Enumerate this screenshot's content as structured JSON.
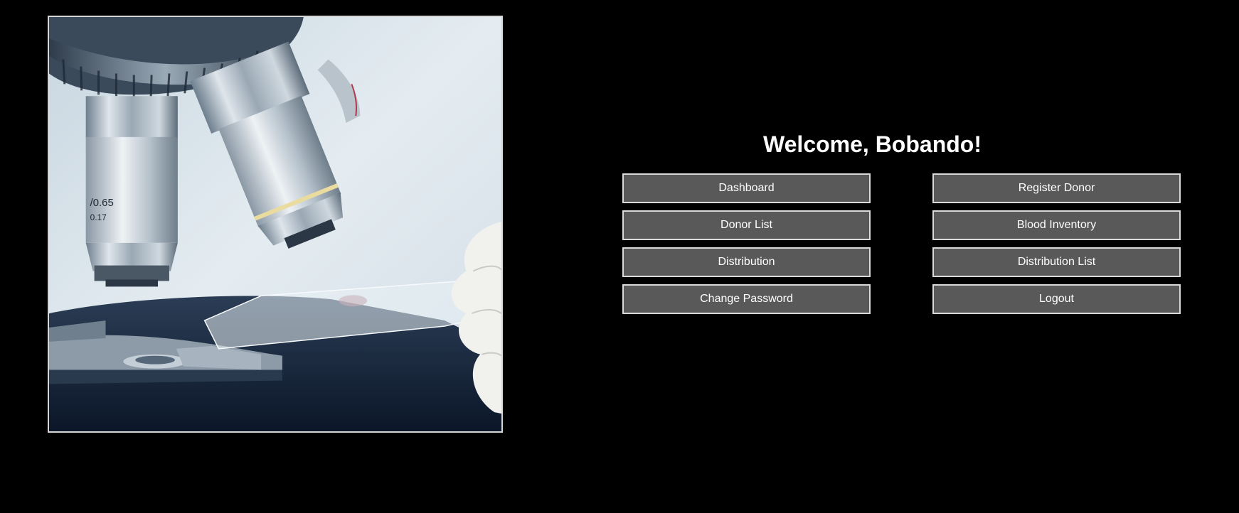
{
  "hero_image": {
    "alt": "microscope-with-slide",
    "objective_labels": [
      "0.65",
      "0.17"
    ]
  },
  "welcome": {
    "text": "Welcome, Bobando!"
  },
  "menu": {
    "dashboard": "Dashboard",
    "register_donor": "Register Donor",
    "donor_list": "Donor List",
    "blood_inventory": "Blood Inventory",
    "distribution": "Distribution",
    "distribution_list": "Distribution List",
    "change_password": "Change Password",
    "logout": "Logout"
  },
  "colors": {
    "background": "#000000",
    "button_bg": "#595959",
    "button_border": "#d9d9d9",
    "text": "#ffffff"
  }
}
